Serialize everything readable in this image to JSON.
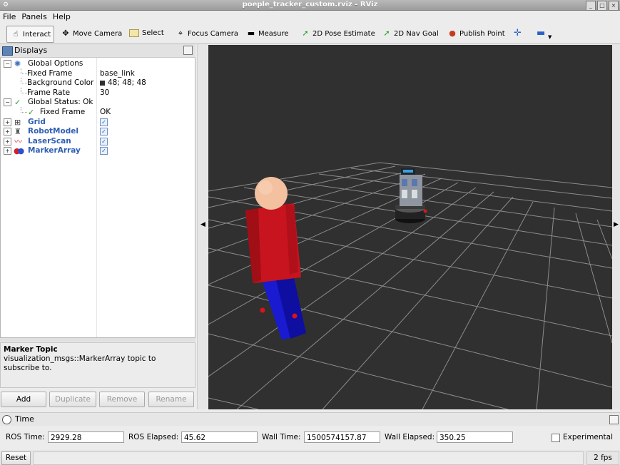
{
  "window": {
    "title": "poeple_tracker_custom.rviz - RViz"
  },
  "menu": [
    "File",
    "Panels",
    "Help"
  ],
  "toolbar": {
    "interact": "Interact",
    "move_camera": "Move Camera",
    "select": "Select",
    "focus_camera": "Focus Camera",
    "measure": "Measure",
    "pose_estimate": "2D Pose Estimate",
    "nav_goal": "2D Nav Goal",
    "publish_point": "Publish Point"
  },
  "displays": {
    "title": "Displays",
    "global_options": "Global Options",
    "fixed_frame_label": "Fixed Frame",
    "fixed_frame_value": "base_link",
    "background_color_label": "Background Color",
    "background_color_value": "48; 48; 48",
    "frame_rate_label": "Frame Rate",
    "frame_rate_value": "30",
    "global_status": "Global Status: Ok",
    "status_fixed_frame_label": "Fixed Frame",
    "status_fixed_frame_value": "OK",
    "items": [
      "Grid",
      "RobotModel",
      "LaserScan",
      "MarkerArray"
    ]
  },
  "description": {
    "title": "Marker Topic",
    "text": "visualization_msgs::MarkerArray topic to subscribe to."
  },
  "buttons": {
    "add": "Add",
    "duplicate": "Duplicate",
    "remove": "Remove",
    "rename": "Rename"
  },
  "time": {
    "title": "Time",
    "ros_time_label": "ROS Time:",
    "ros_time": "2929.28",
    "ros_elapsed_label": "ROS Elapsed:",
    "ros_elapsed": "45.62",
    "wall_time_label": "Wall Time:",
    "wall_time": "1500574157.87",
    "wall_elapsed_label": "Wall Elapsed:",
    "wall_elapsed": "350.25",
    "experimental": "Experimental"
  },
  "status": {
    "reset": "Reset",
    "fps": "2 fps"
  },
  "colors": {
    "viewport_bg": "#303030",
    "grid": "#a0a0a0",
    "person_torso": "#c8141e",
    "person_legs": "#1414c8",
    "person_head": "#f5bfa0"
  }
}
